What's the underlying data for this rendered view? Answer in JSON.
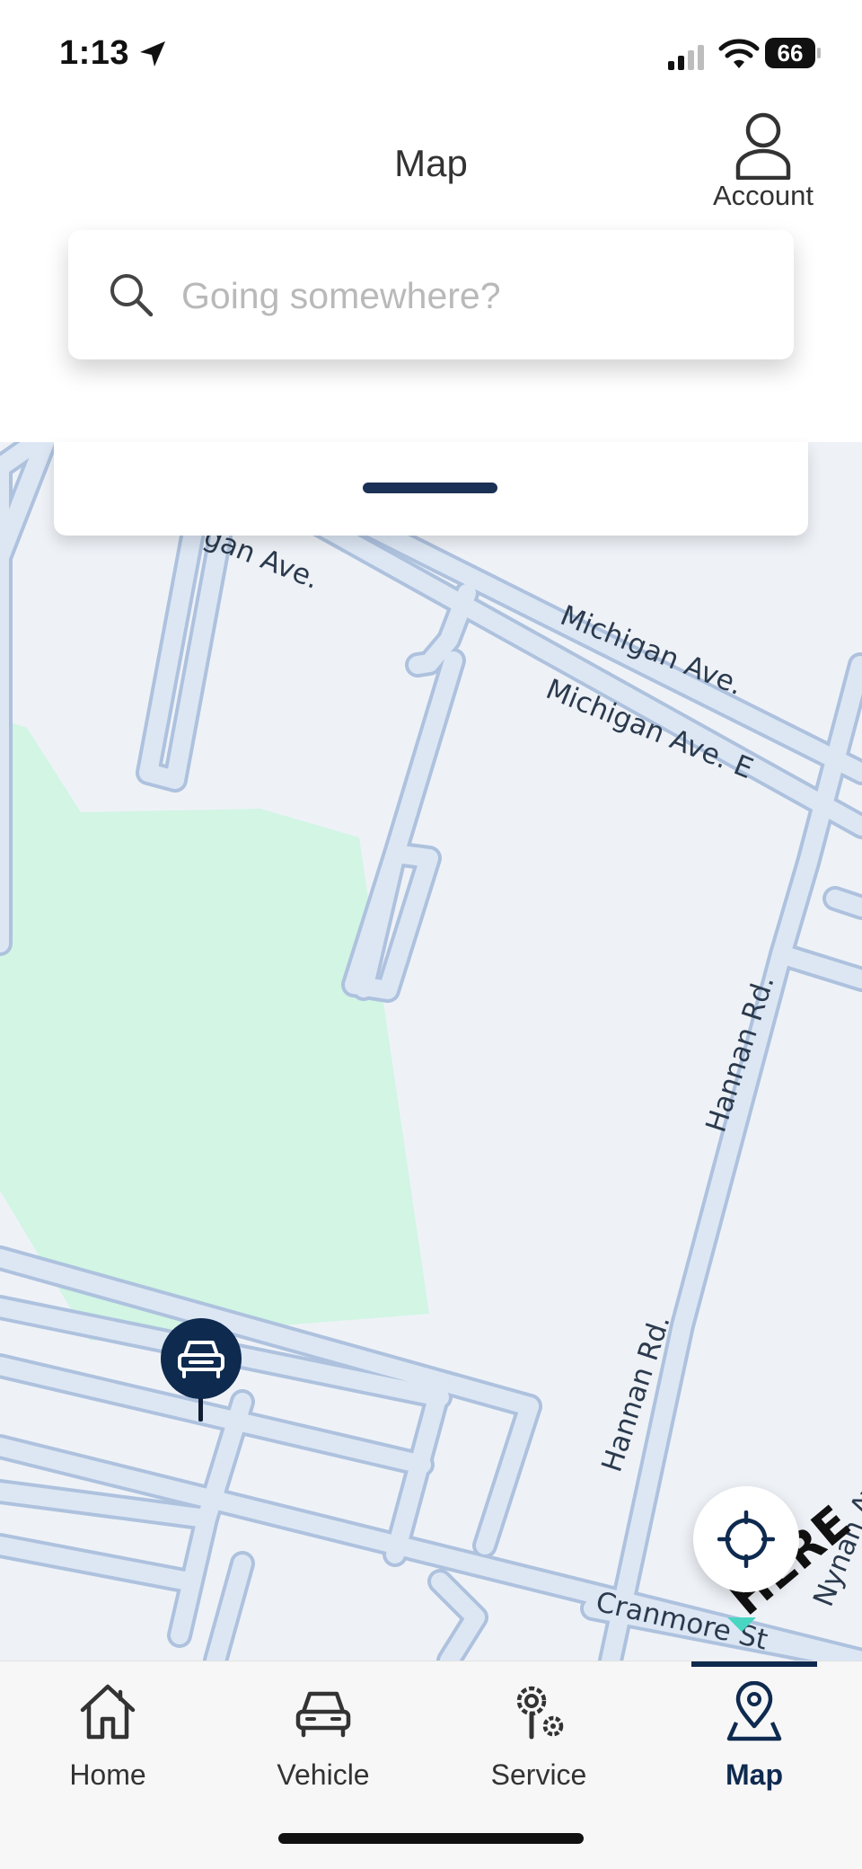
{
  "status": {
    "time": "1:13",
    "battery": "66"
  },
  "header": {
    "title": "Map",
    "account_label": "Account"
  },
  "search": {
    "placeholder": "Going somewhere?"
  },
  "map": {
    "streets": [
      "gan Ave.",
      "Michigan Ave.",
      "Michigan Ave. E",
      "Hannan Rd.",
      "Hannan Rd.",
      "Cranmore St",
      "Nynan Ave"
    ],
    "attribution": "HERE"
  },
  "tabs": [
    {
      "label": "Home",
      "icon": "home-icon"
    },
    {
      "label": "Vehicle",
      "icon": "car-icon"
    },
    {
      "label": "Service",
      "icon": "service-icon"
    },
    {
      "label": "Map",
      "icon": "map-pin-icon",
      "active": true
    }
  ],
  "colors": {
    "brand_navy": "#0f2a4f",
    "map_bg": "#eef2f7",
    "park_green": "#d2f5e4",
    "road_fill": "#dde7f4",
    "road_edge": "#aec2de"
  }
}
